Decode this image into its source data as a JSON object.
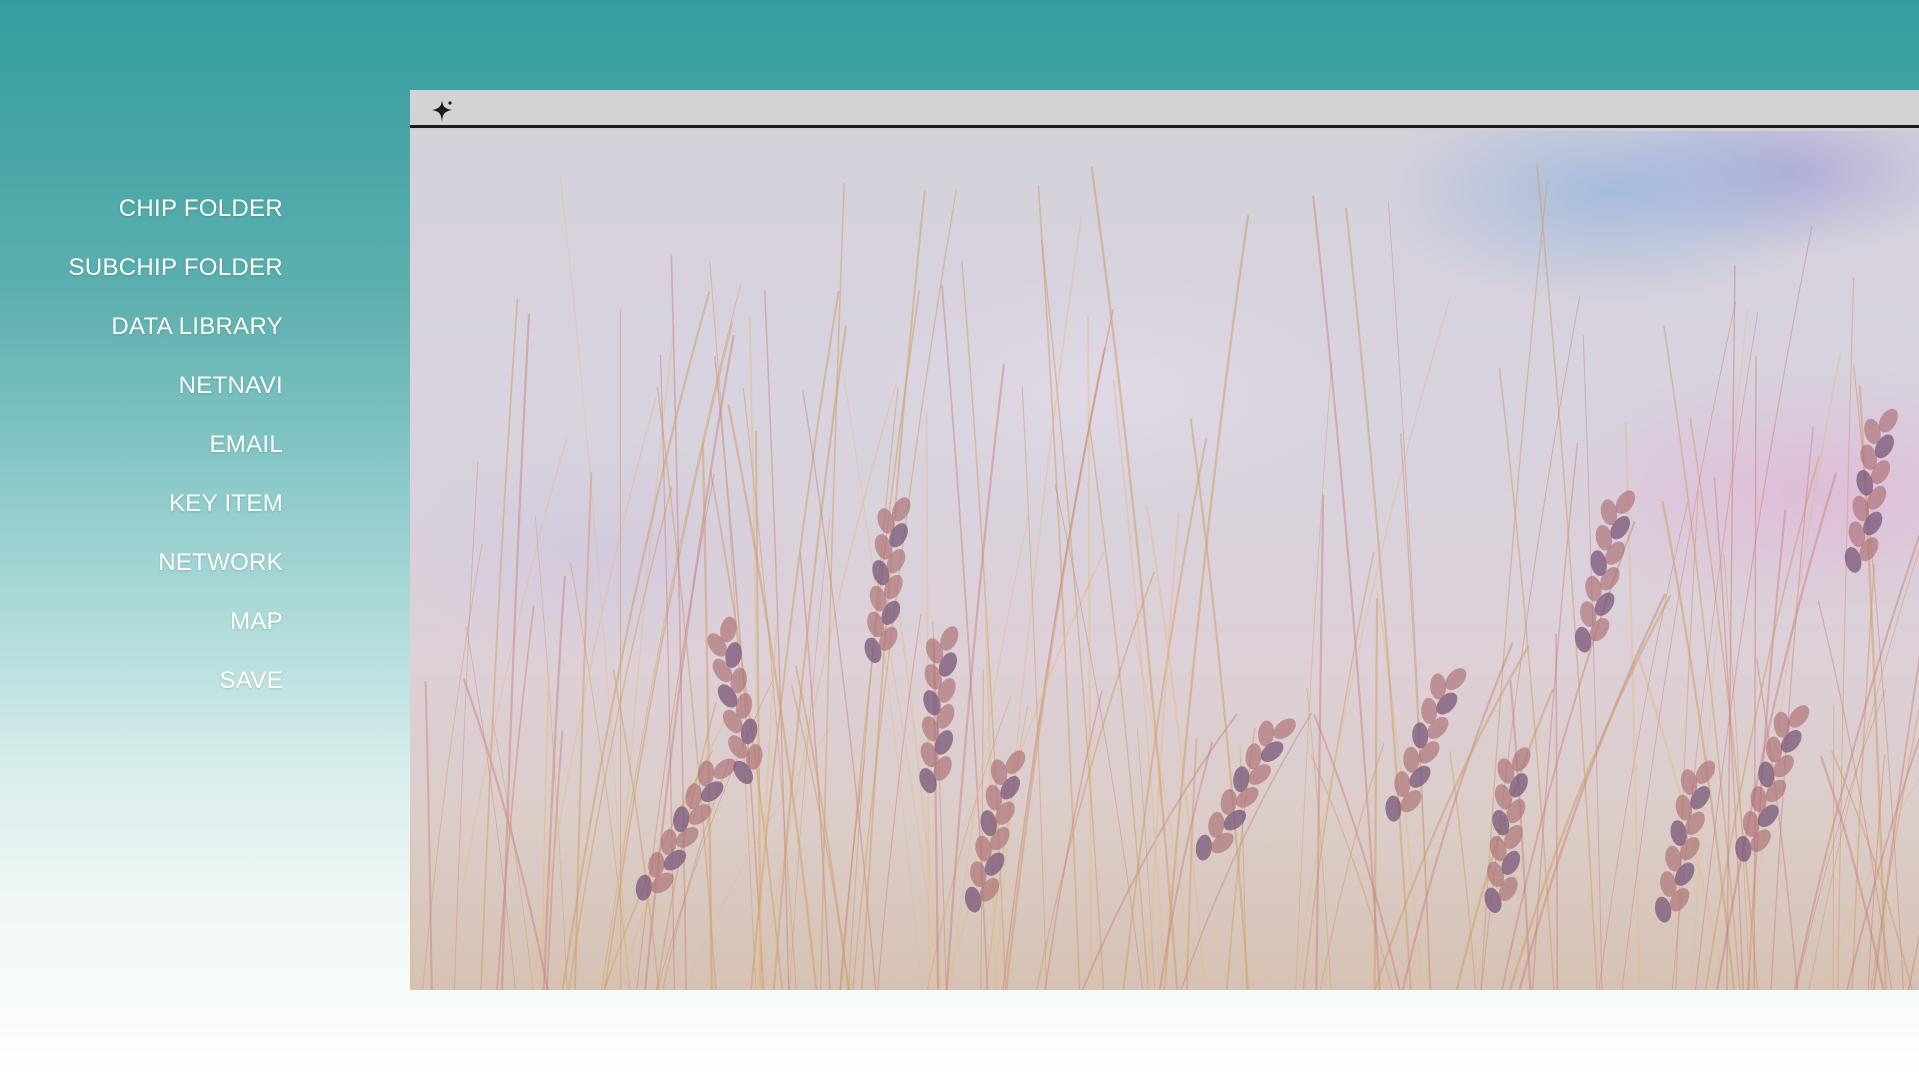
{
  "menu": {
    "items": [
      {
        "label": "CHIP FOLDER",
        "name": "menu-item-chip-folder"
      },
      {
        "label": "SUBCHIP FOLDER",
        "name": "menu-item-subchip-folder"
      },
      {
        "label": "DATA LIBRARY",
        "name": "menu-item-data-library"
      },
      {
        "label": "NETNAVI",
        "name": "menu-item-netnavi"
      },
      {
        "label": "EMAIL",
        "name": "menu-item-email"
      },
      {
        "label": "KEY ITEM",
        "name": "menu-item-key-item"
      },
      {
        "label": "NETWORK",
        "name": "menu-item-network"
      },
      {
        "label": "MAP",
        "name": "menu-item-map"
      },
      {
        "label": "SAVE",
        "name": "menu-item-save"
      }
    ]
  },
  "window": {
    "titlebar_icon": "sparkle-icon",
    "content": "wheat-field-wallpaper"
  },
  "colors": {
    "background_top": "#379e9f",
    "background_bottom": "#ffffff",
    "titlebar": "#d3d3d3",
    "titlebar_border": "#1b1b1b",
    "menu_text": "#ffffff"
  }
}
